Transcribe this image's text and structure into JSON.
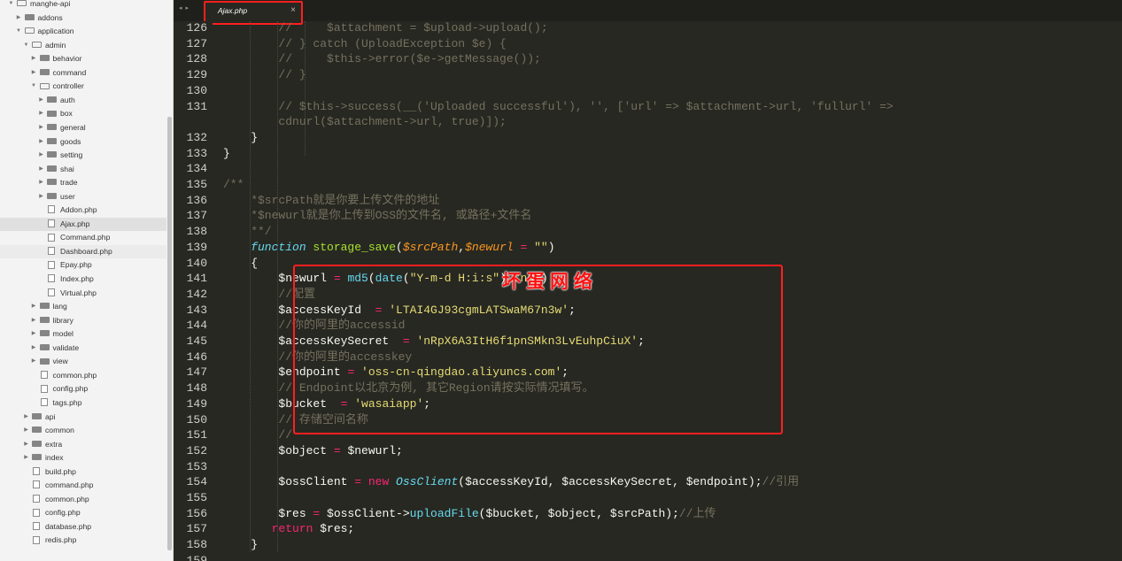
{
  "sidebar": {
    "items": [
      {
        "label": "manghe-api",
        "type": "folder-open",
        "depth": 0
      },
      {
        "label": "addons",
        "type": "folder",
        "depth": 1
      },
      {
        "label": "application",
        "type": "folder-open",
        "depth": 1
      },
      {
        "label": "admin",
        "type": "folder-open",
        "depth": 2
      },
      {
        "label": "behavior",
        "type": "folder",
        "depth": 3
      },
      {
        "label": "command",
        "type": "folder",
        "depth": 3
      },
      {
        "label": "controller",
        "type": "folder-open",
        "depth": 3
      },
      {
        "label": "auth",
        "type": "folder",
        "depth": 4
      },
      {
        "label": "box",
        "type": "folder",
        "depth": 4
      },
      {
        "label": "general",
        "type": "folder",
        "depth": 4
      },
      {
        "label": "goods",
        "type": "folder",
        "depth": 4
      },
      {
        "label": "setting",
        "type": "folder",
        "depth": 4
      },
      {
        "label": "shai",
        "type": "folder",
        "depth": 4
      },
      {
        "label": "trade",
        "type": "folder",
        "depth": 4
      },
      {
        "label": "user",
        "type": "folder",
        "depth": 4
      },
      {
        "label": "Addon.php",
        "type": "file",
        "depth": 4
      },
      {
        "label": "Ajax.php",
        "type": "file",
        "depth": 4,
        "selected": true
      },
      {
        "label": "Command.php",
        "type": "file",
        "depth": 4
      },
      {
        "label": "Dashboard.php",
        "type": "file",
        "depth": 4,
        "hl": true
      },
      {
        "label": "Epay.php",
        "type": "file",
        "depth": 4
      },
      {
        "label": "Index.php",
        "type": "file",
        "depth": 4
      },
      {
        "label": "Virtual.php",
        "type": "file",
        "depth": 4
      },
      {
        "label": "lang",
        "type": "folder",
        "depth": 3
      },
      {
        "label": "library",
        "type": "folder",
        "depth": 3
      },
      {
        "label": "model",
        "type": "folder",
        "depth": 3
      },
      {
        "label": "validate",
        "type": "folder",
        "depth": 3
      },
      {
        "label": "view",
        "type": "folder",
        "depth": 3
      },
      {
        "label": "common.php",
        "type": "file",
        "depth": 3
      },
      {
        "label": "config.php",
        "type": "file",
        "depth": 3
      },
      {
        "label": "tags.php",
        "type": "file",
        "depth": 3
      },
      {
        "label": "api",
        "type": "folder",
        "depth": 2
      },
      {
        "label": "common",
        "type": "folder",
        "depth": 2
      },
      {
        "label": "extra",
        "type": "folder",
        "depth": 2
      },
      {
        "label": "index",
        "type": "folder",
        "depth": 2
      },
      {
        "label": "build.php",
        "type": "file",
        "depth": 2
      },
      {
        "label": "command.php",
        "type": "file",
        "depth": 2
      },
      {
        "label": "common.php",
        "type": "file",
        "depth": 2
      },
      {
        "label": "config.php",
        "type": "file",
        "depth": 2
      },
      {
        "label": "database.php",
        "type": "file",
        "depth": 2
      },
      {
        "label": "redis.php",
        "type": "file",
        "depth": 2
      }
    ]
  },
  "tabbar": {
    "nav_arrows": "◂ ▸",
    "active_tab": "Ajax.php",
    "close_glyph": "×"
  },
  "editor": {
    "line_numbers": [
      "126",
      "127",
      "128",
      "129",
      "130",
      "131",
      "",
      "132",
      "133",
      "134",
      "135",
      "136",
      "137",
      "138",
      "139",
      "140",
      "141",
      "142",
      "143",
      "144",
      "145",
      "146",
      "147",
      "148",
      "149",
      "150",
      "151",
      "152",
      "153",
      "154",
      "155",
      "156",
      "157",
      "158",
      "159"
    ],
    "lines": [
      [
        [
          "c",
          "        //     $attachment = $upload->upload();"
        ]
      ],
      [
        [
          "c",
          "        // } catch (UploadException $e) {"
        ]
      ],
      [
        [
          "c",
          "        //     $this->error($e->getMessage());"
        ]
      ],
      [
        [
          "c",
          "        // }"
        ]
      ],
      [
        [
          "v",
          ""
        ]
      ],
      [
        [
          "c",
          "        // $this->success(__('Uploaded successful'), '', ['url' => $attachment->url, 'fullurl' =>"
        ]
      ],
      [
        [
          "c",
          "        cdnurl($attachment->url, true)]);"
        ]
      ],
      [
        [
          "v",
          "    }"
        ]
      ],
      [
        [
          "v",
          "}"
        ]
      ],
      [
        [
          "v",
          ""
        ]
      ],
      [
        [
          "c",
          "/**"
        ]
      ],
      [
        [
          "c",
          "    *$srcPath就是你要上传文件的地址"
        ]
      ],
      [
        [
          "c",
          "    *$newurl就是你上传到OSS的文件名, 或路径+文件名"
        ]
      ],
      [
        [
          "c",
          "    **/"
        ]
      ],
      [
        [
          "i",
          "    function "
        ],
        [
          "f",
          "storage_save"
        ],
        [
          "v",
          "("
        ],
        [
          "p",
          "$srcPath"
        ],
        [
          "v",
          ","
        ],
        [
          "p",
          "$newurl"
        ],
        [
          "k",
          " = "
        ],
        [
          "s",
          "\"\""
        ],
        [
          "v",
          ")"
        ]
      ],
      [
        [
          "v",
          "    {"
        ]
      ],
      [
        [
          "v",
          "        $newurl "
        ],
        [
          "k",
          "= "
        ],
        [
          "b",
          "md5"
        ],
        [
          "v",
          "("
        ],
        [
          "b",
          "date"
        ],
        [
          "v",
          "("
        ],
        [
          "s",
          "\"Y-m-d H:i:s\""
        ],
        [
          "v",
          ")."
        ],
        [
          "s",
          "\"ng\""
        ],
        [
          "v",
          ")"
        ]
      ],
      [
        [
          "c",
          "        //配置"
        ]
      ],
      [
        [
          "v",
          "        $accessKeyId  "
        ],
        [
          "k",
          "= "
        ],
        [
          "s",
          "'LTAI4GJ93cgmLATSwaM67n3w'"
        ],
        [
          "v",
          ";"
        ]
      ],
      [
        [
          "c",
          "        //你的阿里的accessid"
        ]
      ],
      [
        [
          "v",
          "        $accessKeySecret  "
        ],
        [
          "k",
          "= "
        ],
        [
          "s",
          "'nRpX6A3ItH6f1pnSMkn3LvEuhpCiuX'"
        ],
        [
          "v",
          ";"
        ]
      ],
      [
        [
          "c",
          "        //你的阿里的accesskey"
        ]
      ],
      [
        [
          "v",
          "        $endpoint "
        ],
        [
          "k",
          "= "
        ],
        [
          "s",
          "'oss-cn-qingdao.aliyuncs.com'"
        ],
        [
          "v",
          ";"
        ]
      ],
      [
        [
          "c",
          "        // Endpoint以北京为例, 其它Region请按实际情况填写。"
        ]
      ],
      [
        [
          "v",
          "        $bucket  "
        ],
        [
          "k",
          "= "
        ],
        [
          "s",
          "'wasaiapp'"
        ],
        [
          "v",
          ";"
        ]
      ],
      [
        [
          "c",
          "        // 存储空间名称"
        ]
      ],
      [
        [
          "c",
          "        //"
        ]
      ],
      [
        [
          "v",
          "        $object "
        ],
        [
          "k",
          "= "
        ],
        [
          "v",
          "$newurl;"
        ]
      ],
      [
        [
          "v",
          ""
        ]
      ],
      [
        [
          "v",
          "        $ossClient "
        ],
        [
          "k",
          "= new "
        ],
        [
          "i",
          "OssClient"
        ],
        [
          "v",
          "($accessKeyId, $accessKeySecret, $endpoint);"
        ],
        [
          "c",
          "//引用"
        ]
      ],
      [
        [
          "v",
          ""
        ]
      ],
      [
        [
          "v",
          "        $res "
        ],
        [
          "k",
          "= "
        ],
        [
          "v",
          "$ossClient->"
        ],
        [
          "b",
          "uploadFile"
        ],
        [
          "v",
          "($bucket, $object, $srcPath);"
        ],
        [
          "c",
          "//上传"
        ]
      ],
      [
        [
          "k",
          "       return "
        ],
        [
          "v",
          "$res;"
        ]
      ],
      [
        [
          "v",
          "    }"
        ]
      ],
      [
        [
          "v",
          ""
        ]
      ]
    ]
  },
  "watermark": {
    "text": "坏蛋网络"
  },
  "colors": {
    "editor_bg": "#272822",
    "annotation_red": "#ff1f1f"
  }
}
